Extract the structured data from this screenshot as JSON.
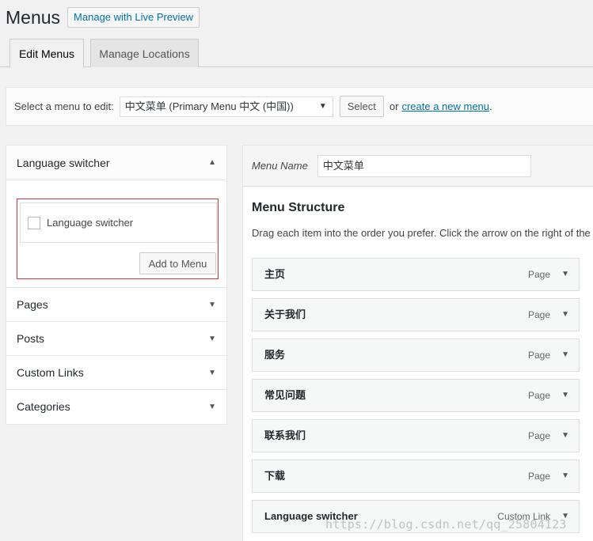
{
  "header": {
    "title": "Menus",
    "live_preview_label": "Manage with Live Preview"
  },
  "tabs": [
    {
      "label": "Edit Menus",
      "active": true
    },
    {
      "label": "Manage Locations",
      "active": false
    }
  ],
  "select_bar": {
    "prompt": "Select a menu to edit:",
    "selected_menu": "中文菜单 (Primary Menu 中文 (中国))",
    "select_label": "Select",
    "or_text": "or",
    "create_link": "create a new menu",
    "create_suffix": "."
  },
  "left_panels": {
    "open_panel": {
      "title": "Language switcher",
      "item_label": "Language switcher",
      "add_button": "Add to Menu"
    },
    "collapsed": [
      "Pages",
      "Posts",
      "Custom Links",
      "Categories"
    ]
  },
  "menu_editor": {
    "name_label": "Menu Name",
    "name_value": "中文菜单",
    "structure_title": "Menu Structure",
    "structure_desc": "Drag each item into the order you prefer. Click the arrow on the right of the",
    "items": [
      {
        "title": "主页",
        "type": "Page"
      },
      {
        "title": "关于我们",
        "type": "Page"
      },
      {
        "title": "服务",
        "type": "Page"
      },
      {
        "title": "常见问题",
        "type": "Page"
      },
      {
        "title": "联系我们",
        "type": "Page"
      },
      {
        "title": "下载",
        "type": "Page"
      },
      {
        "title": "Language switcher",
        "type": "Custom Link"
      }
    ]
  },
  "watermark": "https://blog.csdn.net/qq_25804123",
  "icons": {
    "collapse": "triangle-up-icon",
    "expand": "triangle-down-icon",
    "select_caret": "chevron-down-icon"
  }
}
